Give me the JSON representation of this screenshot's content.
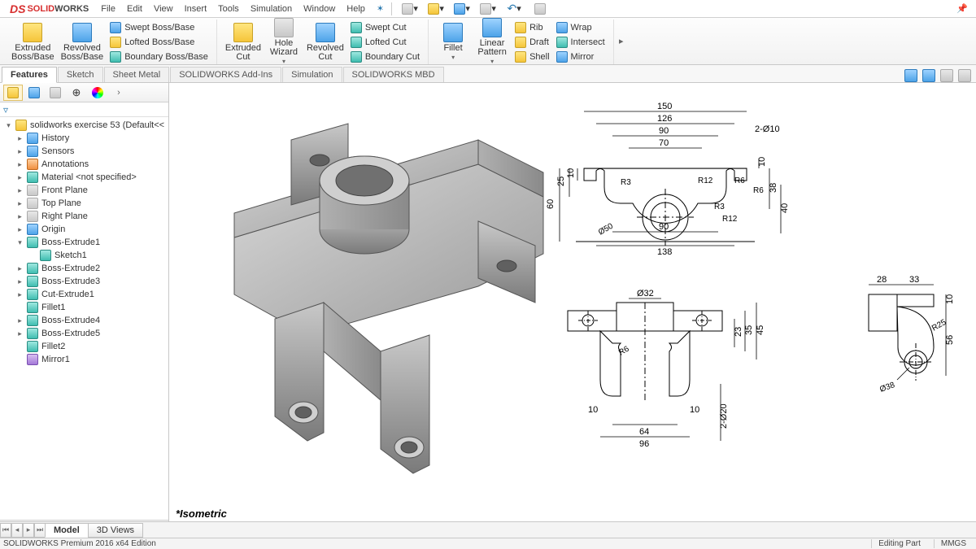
{
  "app": {
    "brand_prefix": "SOLID",
    "brand_suffix": "WORKS"
  },
  "menu": [
    "File",
    "Edit",
    "View",
    "Insert",
    "Tools",
    "Simulation",
    "Window",
    "Help"
  ],
  "ribbon": {
    "features_group1": {
      "extruded": {
        "l1": "Extruded",
        "l2": "Boss/Base"
      },
      "revolved": {
        "l1": "Revolved",
        "l2": "Boss/Base"
      },
      "swept": "Swept Boss/Base",
      "lofted": "Lofted Boss/Base",
      "boundary": "Boundary Boss/Base"
    },
    "features_group2": {
      "extruded_cut": {
        "l1": "Extruded",
        "l2": "Cut"
      },
      "hole": {
        "l1": "Hole",
        "l2": "Wizard"
      },
      "revolved_cut": {
        "l1": "Revolved",
        "l2": "Cut"
      },
      "swept_cut": "Swept Cut",
      "lofted_cut": "Lofted Cut",
      "boundary_cut": "Boundary Cut"
    },
    "features_group3": {
      "fillet": "Fillet",
      "linear": {
        "l1": "Linear",
        "l2": "Pattern"
      },
      "rib": "Rib",
      "draft": "Draft",
      "shell": "Shell",
      "wrap": "Wrap",
      "intersect": "Intersect",
      "mirror": "Mirror"
    }
  },
  "ribtabs": [
    "Features",
    "Sketch",
    "Sheet Metal",
    "SOLIDWORKS Add-Ins",
    "Simulation",
    "SOLIDWORKS MBD"
  ],
  "tree": {
    "root": "solidworks exercise 53  (Default<<",
    "items": [
      {
        "label": "History",
        "ic": "ic-blue"
      },
      {
        "label": "Sensors",
        "ic": "ic-blue"
      },
      {
        "label": "Annotations",
        "ic": "ic-orange"
      },
      {
        "label": "Material <not specified>",
        "ic": "ic-teal"
      },
      {
        "label": "Front Plane",
        "ic": "ic-gray"
      },
      {
        "label": "Top Plane",
        "ic": "ic-gray"
      },
      {
        "label": "Right Plane",
        "ic": "ic-gray"
      },
      {
        "label": "Origin",
        "ic": "ic-blue"
      },
      {
        "label": "Boss-Extrude1",
        "ic": "ic-teal",
        "exp": true
      },
      {
        "label": "Sketch1",
        "ic": "ic-teal",
        "indent": 2
      },
      {
        "label": "Boss-Extrude2",
        "ic": "ic-teal"
      },
      {
        "label": "Boss-Extrude3",
        "ic": "ic-teal"
      },
      {
        "label": "Cut-Extrude1",
        "ic": "ic-teal"
      },
      {
        "label": "Fillet1",
        "ic": "ic-teal",
        "indent": 1,
        "noexp": true
      },
      {
        "label": "Boss-Extrude4",
        "ic": "ic-teal"
      },
      {
        "label": "Boss-Extrude5",
        "ic": "ic-teal"
      },
      {
        "label": "Fillet2",
        "ic": "ic-teal",
        "indent": 1,
        "noexp": true
      },
      {
        "label": "Mirror1",
        "ic": "ic-purple",
        "indent": 1,
        "noexp": true
      }
    ]
  },
  "view_label": "*Isometric",
  "bottom_tabs": [
    "Model",
    "3D Views"
  ],
  "status": {
    "left": "SOLIDWORKS Premium 2016 x64 Edition",
    "mode": "Editing Part",
    "units": "MMGS"
  },
  "drawing_dims": {
    "top_view": [
      "150",
      "126",
      "90",
      "70",
      "90",
      "138",
      "60",
      "25",
      "10",
      "38",
      "40",
      "10",
      "2-Ø10",
      "R3",
      "R12",
      "R6",
      "R6",
      "R3",
      "R12",
      "Ø50"
    ],
    "front_view": [
      "Ø32",
      "10",
      "10",
      "64",
      "96",
      "R6",
      "23",
      "35",
      "45",
      "2-Ø20"
    ],
    "side_view": [
      "28",
      "33",
      "10",
      "56",
      "R25",
      "Ø38"
    ]
  }
}
